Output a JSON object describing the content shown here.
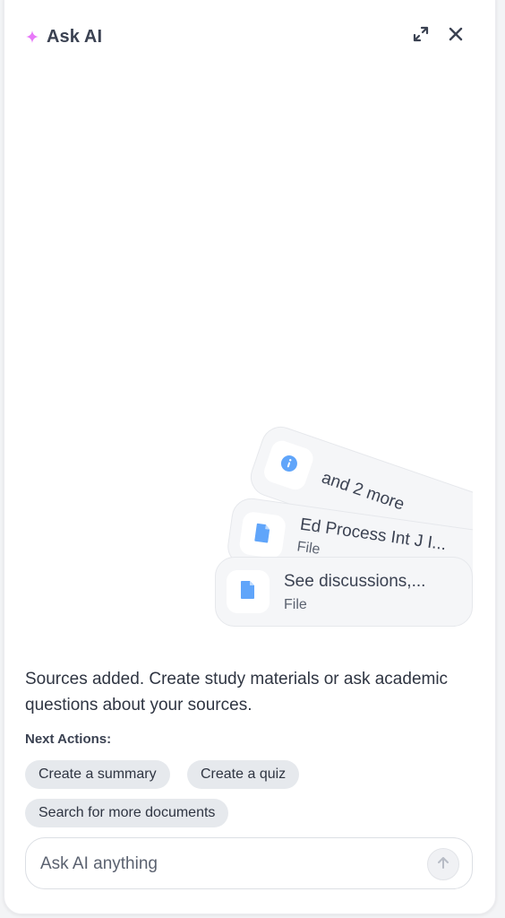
{
  "header": {
    "title": "Ask AI",
    "icons": [
      "sparkle-icon",
      "expand-icon",
      "close-icon"
    ],
    "sparkle_color": "#e879f9"
  },
  "sources": {
    "cards": [
      {
        "name": "and 2 more",
        "icon": "info-icon"
      },
      {
        "name": "Ed Process Int J I...",
        "kind": "File",
        "icon": "file-icon"
      },
      {
        "name": "See discussions,...",
        "kind": "File",
        "icon": "file-icon"
      }
    ],
    "icon_color": "#60a5fa"
  },
  "message": {
    "text": "Sources added. Create study materials or ask academic questions about your sources."
  },
  "next_actions": {
    "label": "Next Actions:",
    "chips": [
      "Create a summary",
      "Create a quiz",
      "Search for more documents"
    ]
  },
  "composer": {
    "placeholder": "Ask AI anything",
    "send_icon": "arrow-up-icon"
  }
}
